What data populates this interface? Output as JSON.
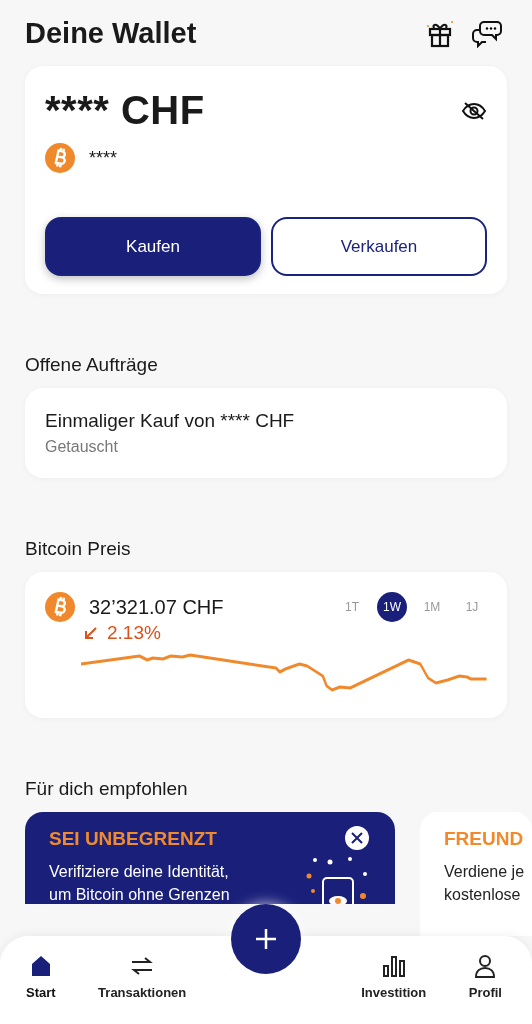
{
  "header": {
    "title": "Deine Wallet"
  },
  "balance": {
    "amount": "**** CHF",
    "crypto_amount": "****",
    "hidden": true
  },
  "actions": [
    {
      "label": "Kaufen",
      "kind": "primary"
    },
    {
      "label": "Verkaufen",
      "kind": "secondary"
    }
  ],
  "open_orders": {
    "title": "Offene Aufträge",
    "items": [
      {
        "title": "Einmaliger Kauf von **** CHF",
        "status": "Getauscht"
      }
    ]
  },
  "price": {
    "title": "Bitcoin Preis",
    "value": "32’321.07 CHF",
    "change": "2.13%",
    "ranges": [
      {
        "label": "1T",
        "selected": false
      },
      {
        "label": "1W",
        "selected": true
      },
      {
        "label": "1M",
        "selected": false
      },
      {
        "label": "1J",
        "selected": false
      }
    ]
  },
  "recommended": {
    "title": "Für dich empfohlen",
    "cards": [
      {
        "kind": "dark",
        "title": "SEI UNBEGRENZT",
        "lines": [
          "Verifiziere deine Identität,",
          "um Bitcoin ohne Grenzen"
        ],
        "closable": true
      },
      {
        "kind": "light",
        "title": "FREUND",
        "lines": [
          "Verdiene je",
          "kostenlose"
        ],
        "closable": false
      }
    ]
  },
  "nav": [
    {
      "label": "Start",
      "selected": true
    },
    {
      "label": "Transaktionen",
      "selected": false
    },
    {
      "label": "Investition",
      "selected": false
    },
    {
      "label": "Profil",
      "selected": false
    }
  ]
}
